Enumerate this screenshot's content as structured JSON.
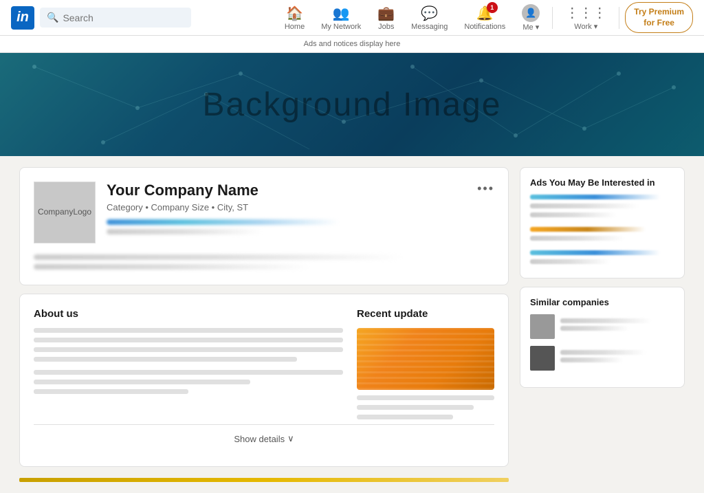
{
  "nav": {
    "logo_letter": "in",
    "search_placeholder": "Search",
    "items": [
      {
        "id": "home",
        "label": "Home",
        "icon": "🏠",
        "badge": null
      },
      {
        "id": "network",
        "label": "My Network",
        "icon": "👥",
        "badge": null
      },
      {
        "id": "jobs",
        "label": "Jobs",
        "icon": "💼",
        "badge": null
      },
      {
        "id": "messaging",
        "label": "Messaging",
        "icon": "💬",
        "badge": null
      },
      {
        "id": "notifications",
        "label": "Notifications",
        "icon": "🔔",
        "badge": "1"
      },
      {
        "id": "me",
        "label": "Me ▾",
        "icon": "avatar",
        "badge": null
      },
      {
        "id": "work",
        "label": "Work ▾",
        "icon": "⋮⋮⋮",
        "badge": null
      }
    ],
    "premium_label": "Try Premium",
    "premium_sub": "for Free"
  },
  "ads_banner": "Ads and notices display here",
  "hero": {
    "text": "Background Image"
  },
  "company_card": {
    "logo_line1": "Company",
    "logo_line2": "Logo",
    "name": "Your Company Name",
    "meta": "Category • Company Size • City, ST",
    "dots": "•••"
  },
  "about": {
    "title": "About us",
    "recent_title": "Recent update",
    "show_details": "Show details",
    "chevron": "∨"
  },
  "sidebar": {
    "ads_title": "Ads You May Be Interested in",
    "similar_title": "Similar companies"
  }
}
